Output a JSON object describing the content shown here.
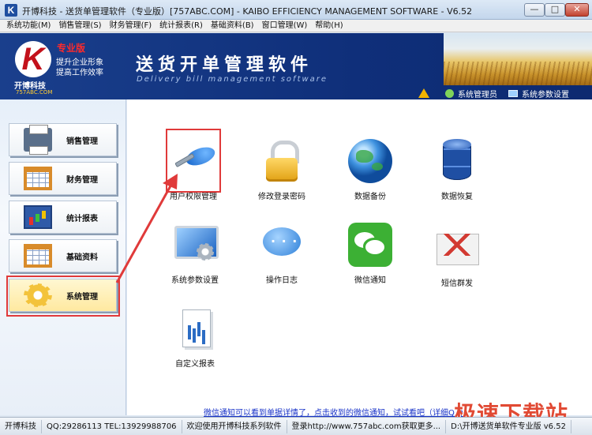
{
  "window": {
    "app_icon": "K",
    "title": "开博科技 - 送货单管理软件（专业版）[757ABC.COM] - KAIBO EFFICIENCY MANAGEMENT SOFTWARE - V6.52",
    "minimize": "—",
    "maximize": "□",
    "close": "✕"
  },
  "menu": [
    "系统功能(M)",
    "销售管理(S)",
    "财务管理(F)",
    "统计报表(R)",
    "基础资料(B)",
    "窗口管理(W)",
    "帮助(H)"
  ],
  "banner": {
    "logo_letter": "K",
    "company": "开博科技",
    "url": "757ABC.COM",
    "edition": "专业版",
    "slogan1": "提升企业形象",
    "slogan2": "提高工作效率",
    "title": "送货开单管理软件",
    "subtitle": "Delivery bill management software",
    "user": "系统管理员",
    "settings": "系统参数设置"
  },
  "sidebar": [
    {
      "label": "销售管理",
      "icon": "printer-icon"
    },
    {
      "label": "财务管理",
      "icon": "spreadsheet-icon"
    },
    {
      "label": "统计报表",
      "icon": "bar-chart-icon"
    },
    {
      "label": "基础资料",
      "icon": "spreadsheet-icon"
    },
    {
      "label": "系统管理",
      "icon": "gear-icon"
    }
  ],
  "tiles": [
    {
      "label": "用户权限管理",
      "icon": "key-icon"
    },
    {
      "label": "修改登录密码",
      "icon": "lock-icon"
    },
    {
      "label": "数据备份",
      "icon": "globe-icon"
    },
    {
      "label": "数据恢复",
      "icon": "database-icon"
    },
    {
      "label": "系统参数设置",
      "icon": "monitor-gear-icon"
    },
    {
      "label": "操作日志",
      "icon": "chat-bubble-icon"
    },
    {
      "label": "微信通知",
      "icon": "wechat-icon"
    },
    {
      "label": "短信群发",
      "icon": "mail-icon"
    },
    {
      "label": "自定义报表",
      "icon": "report-icon"
    }
  ],
  "notice": "微信通知可以看到单据详情了，点击收到的微信通知，试试看吧（详细Q Q",
  "watermark": "极速下载站",
  "status": {
    "company": "开博科技",
    "contact": "QQ:29286113 TEL:13929988706",
    "welcome": "欢迎使用开博科技系列软件",
    "login": "登录http://www.757abc.com获取更多...",
    "path": "D:\\开博送货单软件专业版 v6.52"
  },
  "colors": {
    "banner": "#0f2f7a",
    "highlight_frame": "#e03a3a",
    "notice_link": "#1833c8"
  }
}
